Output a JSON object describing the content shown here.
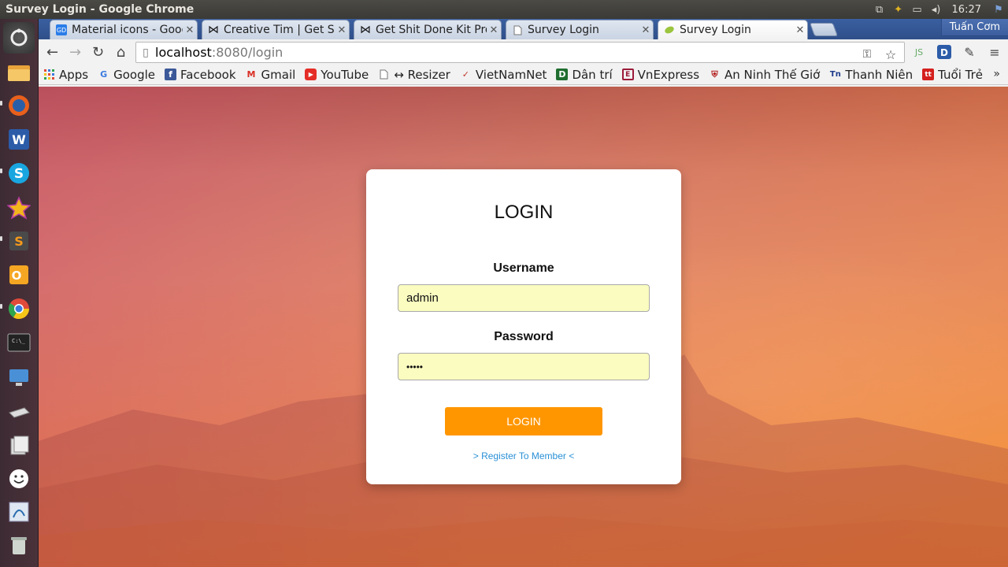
{
  "window": {
    "title": "Survey Login - Google Chrome"
  },
  "tray": {
    "time": "16:27"
  },
  "launcher": {
    "items": [
      "dash-icon",
      "files-icon",
      "firefox-icon",
      "word-icon",
      "skype-icon",
      "star-app-icon",
      "sublime-icon",
      "outlook-icon",
      "chrome-icon",
      "terminal-icon",
      "remote-desktop-icon",
      "drive-icon",
      "software-center-icon",
      "smiley-app-icon",
      "workbench-icon",
      "trash-icon"
    ]
  },
  "tabs": [
    {
      "label": "Material icons - Goog",
      "favicon": "GD"
    },
    {
      "label": "Creative Tim | Get Sh",
      "favicon": "⋈"
    },
    {
      "label": "Get Shit Done Kit Pro",
      "favicon": "⋈"
    },
    {
      "label": "Survey Login",
      "favicon": "page"
    },
    {
      "label": "Survey Login",
      "favicon": "leaf"
    }
  ],
  "profile": {
    "name": "Tuấn Cơm"
  },
  "address": {
    "host": "localhost",
    "rest": ":8080/login"
  },
  "bookmarks": [
    {
      "label": "Apps",
      "icon": "apps-grid"
    },
    {
      "label": "Google",
      "icon": "G"
    },
    {
      "label": "Facebook",
      "icon": "f"
    },
    {
      "label": "Gmail",
      "icon": "M"
    },
    {
      "label": "YouTube",
      "icon": "yt"
    },
    {
      "label": "↔ Resizer",
      "icon": "page"
    },
    {
      "label": "VietNamNet",
      "icon": "check"
    },
    {
      "label": "Dân trí",
      "icon": "D"
    },
    {
      "label": "VnExpress",
      "icon": "E"
    },
    {
      "label": "An Ninh Thế Giớ",
      "icon": "shield"
    },
    {
      "label": "Thanh Niên",
      "icon": "Tn"
    },
    {
      "label": "Tuổi Trẻ",
      "icon": "tt"
    }
  ],
  "login": {
    "title": "LOGIN",
    "username_label": "Username",
    "username_value": "admin",
    "password_label": "Password",
    "password_value": "•••••",
    "button": "LOGIN",
    "register": "> Register To Member <"
  },
  "colors": {
    "accent": "#ff9600",
    "link": "#2a90d6",
    "input_bg": "#fafcc0"
  }
}
